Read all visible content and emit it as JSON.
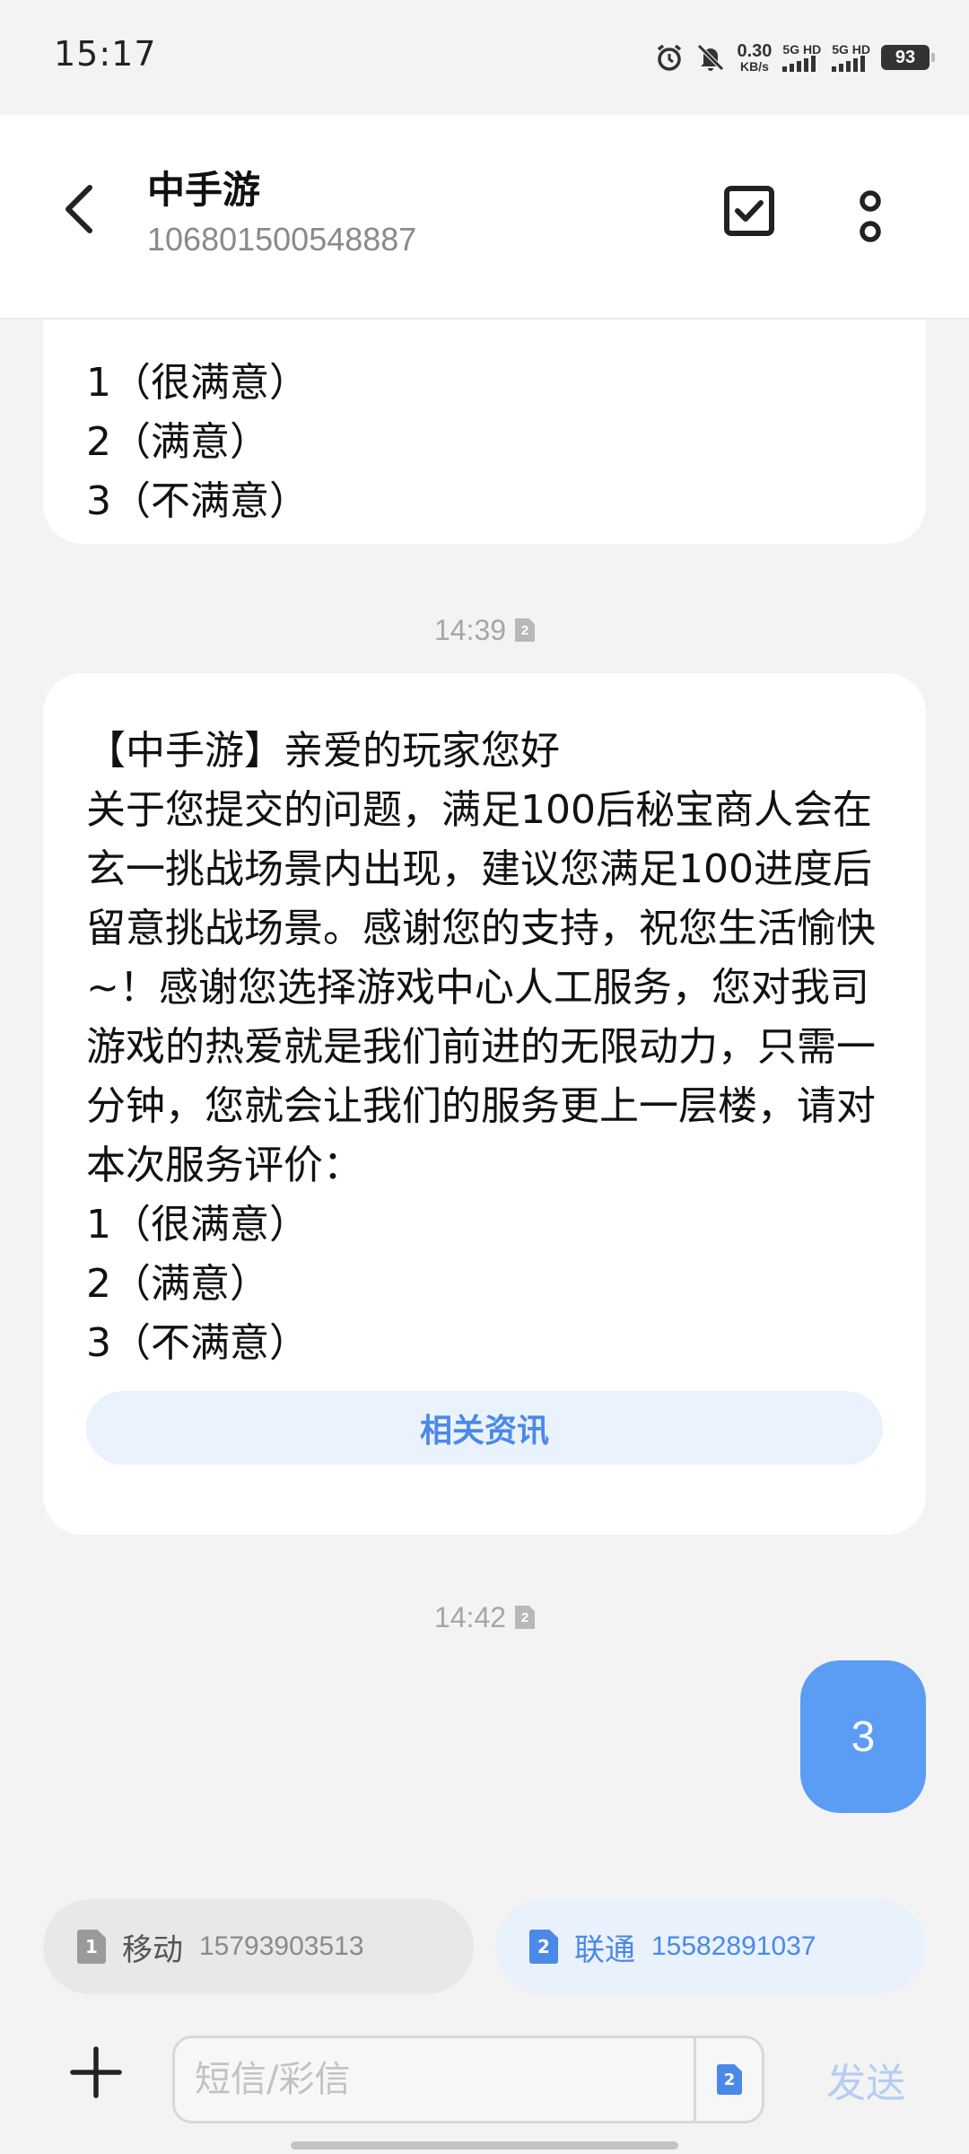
{
  "status_bar": {
    "time": "15:17",
    "net_speed_value": "0.30",
    "net_speed_unit": "KB/s",
    "sim1_label": "5G HD",
    "sim2_label": "5G HD",
    "battery": "93",
    "icons": [
      "alarm-icon",
      "mute-icon"
    ]
  },
  "header": {
    "contact_name": "中手游",
    "contact_number": "106801500548887",
    "icons": [
      "back-arrow-icon",
      "checkbox-icon",
      "more-vertical-icon"
    ]
  },
  "messages": {
    "previous_bubble_tail": [
      "1（很满意）",
      "2（满意）",
      "3（不满意）"
    ],
    "timestamp_1": "14:39",
    "timestamp_1_sim": "2",
    "main_bubble": {
      "text": "【中手游】亲爱的玩家您好\n关于您提交的问题，满足100后秘宝商人会在玄一挑战场景内出现，建议您满足100进度后留意挑战场景。感谢您的支持，祝您生活愉快~！感谢您选择游戏中心人工服务，您对我司游戏的热爱就是我们前进的无限动力，只需一分钟，您就会让我们的服务更上一层楼，请对本次服务评价：\n1（很满意）\n2（满意）\n3（不满意）",
      "related_button": "相关资讯"
    },
    "timestamp_2": "14:42",
    "timestamp_2_sim": "2",
    "outgoing_text": "3"
  },
  "sim_selector": {
    "sim1": {
      "index": "1",
      "carrier": "移动",
      "number": "15793903513"
    },
    "sim2": {
      "index": "2",
      "carrier": "联通",
      "number": "15582891037"
    }
  },
  "composer": {
    "placeholder": "短信/彩信",
    "sim_index": "2",
    "send_label": "发送"
  },
  "colors": {
    "accent": "#4a89e8",
    "outgoing_bubble": "#5b9cf5",
    "background": "#f3f3f3"
  }
}
